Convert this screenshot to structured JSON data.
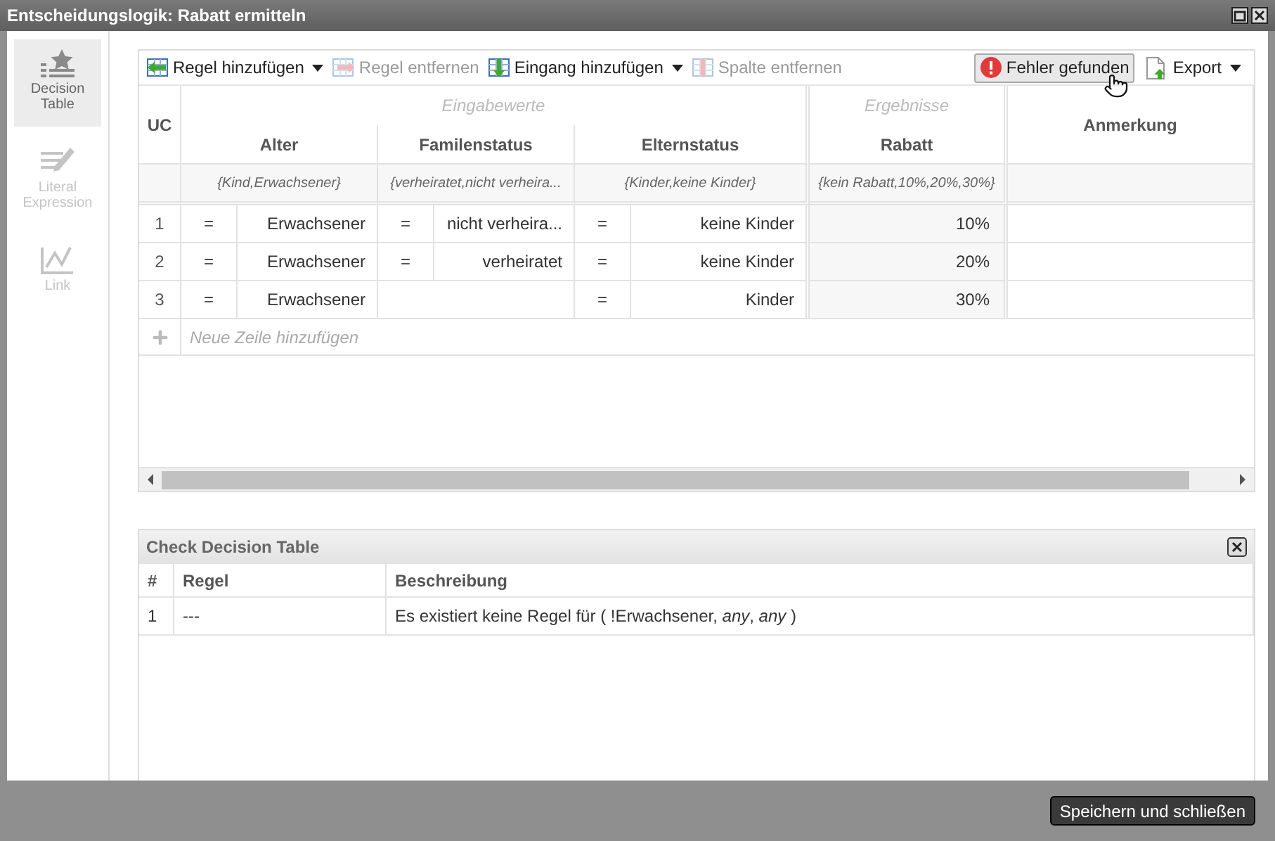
{
  "window": {
    "title": "Entscheidungslogik: Rabatt ermitteln"
  },
  "sidebar": {
    "items": [
      {
        "kind": "table",
        "label": "Decision Table",
        "selected": true,
        "disabled": false
      },
      {
        "kind": "literal",
        "label": "Literal Expression",
        "selected": false,
        "disabled": true
      },
      {
        "kind": "link",
        "label": "Link",
        "selected": false,
        "disabled": true
      }
    ]
  },
  "toolbar": {
    "left": [
      {
        "kind": "add-rule",
        "label": "Regel hinzufügen",
        "disabled": false,
        "dropdown": true
      },
      {
        "kind": "remove-rule",
        "label": "Regel entfernen",
        "disabled": true,
        "dropdown": false
      },
      {
        "kind": "add-input",
        "label": "Eingang hinzufügen",
        "disabled": false,
        "dropdown": true
      },
      {
        "kind": "remove-column",
        "label": "Spalte entfernen",
        "disabled": true,
        "dropdown": false
      }
    ],
    "right": [
      {
        "kind": "error",
        "label": "Fehler gefunden",
        "hovered": true,
        "dropdown": false
      },
      {
        "kind": "export",
        "label": "Export",
        "hovered": false,
        "dropdown": true
      }
    ]
  },
  "table": {
    "uc_label": "UC",
    "input_group": "Eingabewerte",
    "output_group": "Ergebnisse",
    "annotation": "Anmerkung",
    "inputs": [
      {
        "name": "Alter",
        "values": "{Kind,Erwachsener}"
      },
      {
        "name": "Familenstatus",
        "values": "{verheiratet,nicht verheira..."
      },
      {
        "name": "Elternstatus",
        "values": "{Kinder,keine Kinder}"
      }
    ],
    "outputs": [
      {
        "name": "Rabatt",
        "values": "{kein Rabatt,10%,20%,30%}"
      }
    ],
    "rules": [
      {
        "number": "1",
        "inputs": [
          {
            "kind": "condition",
            "op": "=",
            "value": "Erwachsener"
          },
          {
            "kind": "condition",
            "op": "=",
            "value": "nicht verheira..."
          },
          {
            "kind": "condition",
            "op": "=",
            "value": "keine Kinder"
          }
        ],
        "outputs": [
          "10%"
        ]
      },
      {
        "number": "2",
        "inputs": [
          {
            "kind": "condition",
            "op": "=",
            "value": "Erwachsener"
          },
          {
            "kind": "condition",
            "op": "=",
            "value": "verheiratet"
          },
          {
            "kind": "condition",
            "op": "=",
            "value": "keine Kinder"
          }
        ],
        "outputs": [
          "20%"
        ]
      },
      {
        "number": "3",
        "inputs": [
          {
            "kind": "condition",
            "op": "=",
            "value": "Erwachsener"
          },
          {
            "kind": "blank"
          },
          {
            "kind": "condition",
            "op": "=",
            "value": "Kinder"
          }
        ],
        "outputs": [
          "30%"
        ]
      }
    ],
    "add_row": "Neue Zeile hinzufügen"
  },
  "check_panel": {
    "title": "Check Decision Table",
    "columns": [
      "#",
      "Regel",
      "Beschreibung"
    ],
    "rows": [
      {
        "cells": [
          "1",
          "---",
          "Es existiert keine Regel für ( !Erwachsener, *any*, *any* )"
        ]
      }
    ]
  },
  "footer": {
    "button": "Speichern und schließen"
  }
}
